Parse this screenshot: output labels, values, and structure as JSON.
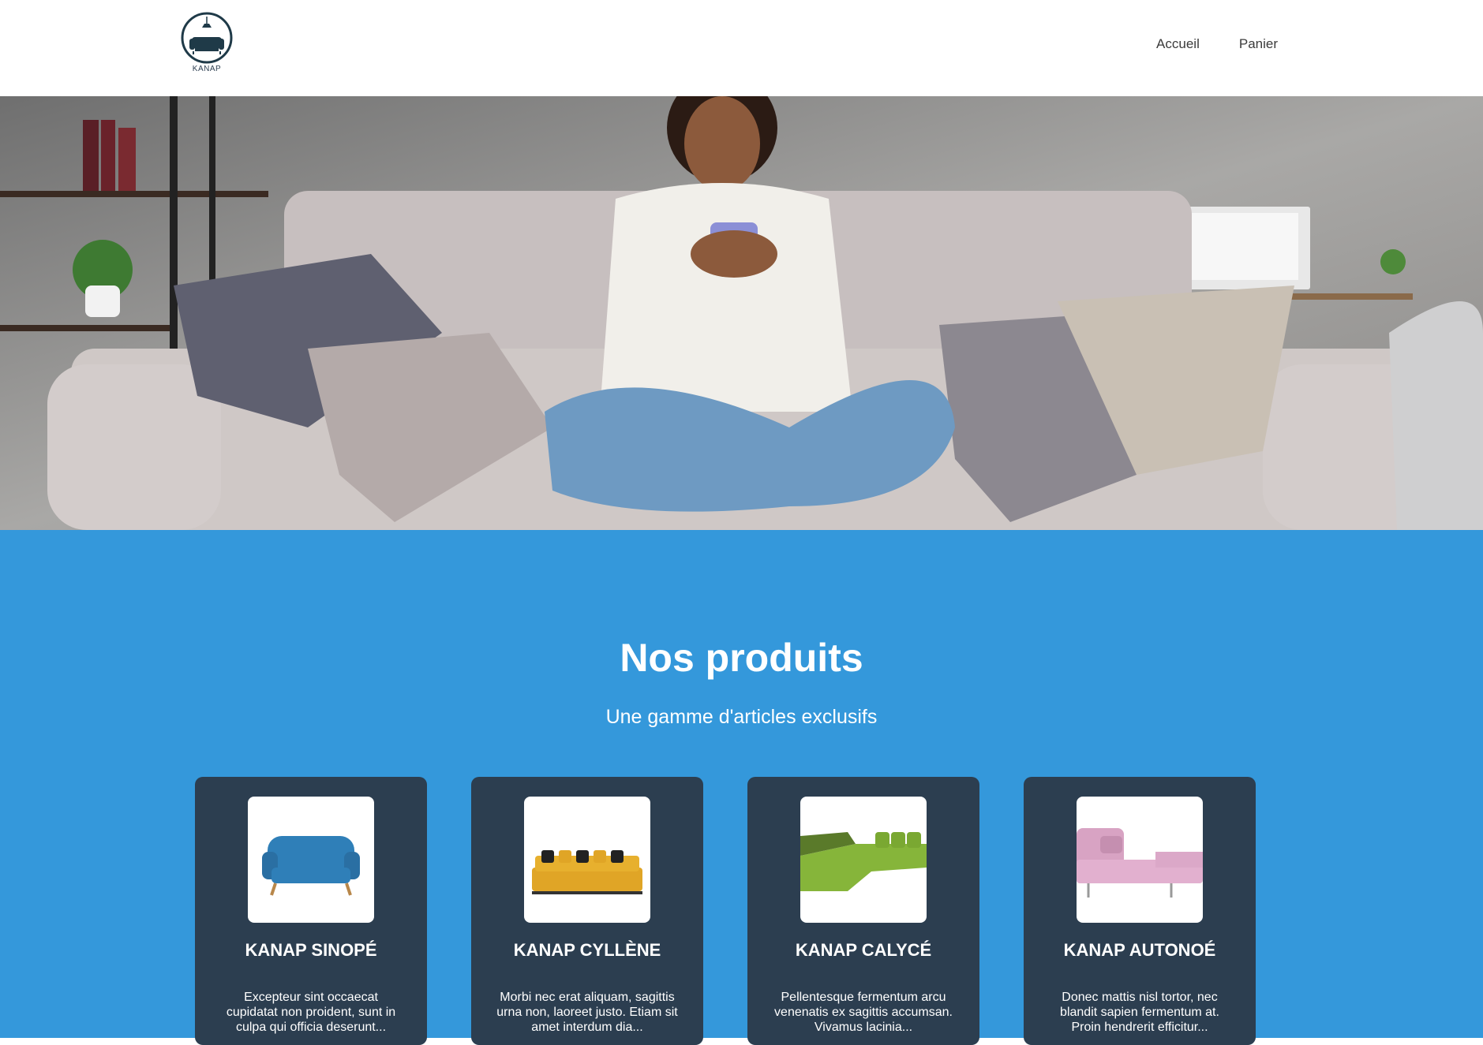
{
  "header": {
    "logo_text": "KANAP",
    "nav": [
      {
        "label": "Accueil"
      },
      {
        "label": "Panier"
      }
    ]
  },
  "hero": {
    "image_icon": "woman-on-sofa-photo"
  },
  "products": {
    "title": "Nos produits",
    "subtitle": "Une gamme d'articles exclusifs",
    "items": [
      {
        "name": "KANAP SINOPÉ",
        "description": "Excepteur sint occaecat cupidatat non proident, sunt in culpa qui officia deserunt...",
        "color": "#2f7fb8"
      },
      {
        "name": "KANAP CYLLÈNE",
        "description": "Morbi nec erat aliquam, sagittis urna non, laoreet justo. Etiam sit amet interdum dia...",
        "color": "#e0a526"
      },
      {
        "name": "KANAP CALYCÉ",
        "description": "Pellentesque fermentum arcu venenatis ex sagittis accumsan. Vivamus lacinia...",
        "color": "#86b53a"
      },
      {
        "name": "KANAP AUTONOÉ",
        "description": "Donec mattis nisl tortor, nec blandit sapien fermentum at. Proin hendrerit efficitur...",
        "color": "#d8a3c3"
      }
    ]
  },
  "colors": {
    "accent": "#3498db",
    "card_bg": "#2c3e50"
  }
}
